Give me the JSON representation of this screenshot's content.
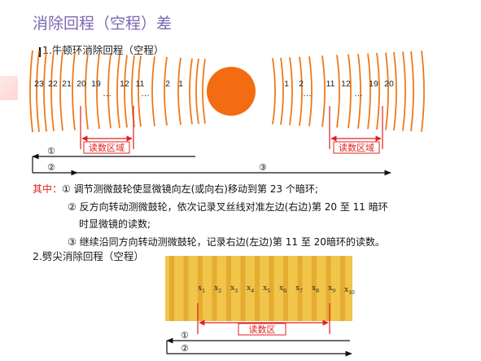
{
  "title": "消除回程（空程）差",
  "section1": "1.牛顿环消除回程（空程）",
  "newton": {
    "left_numbers": [
      "23",
      "22",
      "21",
      "20",
      "19",
      "12",
      "11",
      "2",
      "1"
    ],
    "right_numbers": [
      "1",
      "2",
      "11",
      "12",
      "19",
      "20"
    ],
    "ellipsis": "…",
    "read_region": "读数区域",
    "arrow1": "①",
    "arrow2": "②",
    "arrow3": "③"
  },
  "notes": {
    "lead": "其中：",
    "step1": "① 调节测微鼓轮使显微镜向左(或向右)移动到第 23 个暗环;",
    "step2a": "② 反方向转动测微鼓轮，依次记录叉丝线对准左边(右边)第 20 至 11 暗环",
    "step2b": "时显微镜的读数;",
    "step3": "③ 继续沿同方向转动测微鼓轮，记录右边(左边)第 11 至 20暗环的读数。"
  },
  "section2": "2.劈尖消除回程（空程）",
  "wedge": {
    "labels": [
      "x",
      "x",
      "x",
      "x",
      "x",
      "x",
      "x",
      "x",
      "x",
      "x"
    ],
    "subs": [
      "1",
      "2",
      "3",
      "4",
      "5",
      "6",
      "7",
      "8",
      "9",
      "10"
    ],
    "read_region": "读数区",
    "arrow1": "①",
    "arrow2": "②"
  },
  "colors": {
    "title": "#7a68b0",
    "accent_red": "#e02020",
    "ring_orange": "#f07818",
    "sun": "#f36c12",
    "wedge_yellow": "#f1c44a",
    "wedge_stripe": "#d89a1c"
  }
}
